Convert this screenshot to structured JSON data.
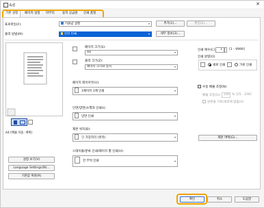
{
  "window": {
    "title": "속성",
    "close_glyph": "✕"
  },
  "tabs": [
    "기본 설정",
    "페이지 설정",
    "마무리",
    "용지 공급원",
    "인쇄 품질"
  ],
  "profile": {
    "label": "프로파일(F):",
    "value": "기본값 설정",
    "add_button": "추가(1)...",
    "edit_button": "편집(2)..."
  },
  "output_method": {
    "label": "출력 방법(M):",
    "value": "보안 인쇄",
    "details_button": "세부 정보(3)..."
  },
  "preview": {
    "caption": "A4 [배율 자동: 계획]"
  },
  "left_buttons": [
    "설정 보기(V)",
    "Language Settings(N)...",
    "기본값 복원(R)"
  ],
  "page_size": {
    "label": "페이지 크기(S):",
    "value": "A4"
  },
  "output_size": {
    "label": "출력 크기(Z):",
    "value": "페이지 크기와 일치"
  },
  "copies": {
    "label": "인쇄 매수(C):",
    "value": "1",
    "range": "[1 - 9999]"
  },
  "orientation": {
    "label": "인쇄 방향(O)",
    "portrait": "세로 인쇄",
    "landscape": "가로 인쇄"
  },
  "page_layout": {
    "label": "페이지 레이아웃(U):",
    "value": "1페이지 1매 인쇄"
  },
  "manual_scaling": {
    "checkbox": "수동 배율 조정(N)",
    "scale_label": "배율 조정(G):",
    "scale_value": "100",
    "scale_range": "% [25 - 200]",
    "fit_label": "원본을 가로/세로에 맞춤(X)"
  },
  "duplex": {
    "label": "단면/양면/소책자 인쇄(I):",
    "value": "양면 인쇄"
  },
  "binding": {
    "label": "제본 위치(B):",
    "value": "긴 가장자리 (왼쪽)",
    "margin_button": "제본 여백(G)..."
  },
  "staple": {
    "label": "스태이플/분류 인쇄/페이지 별 인쇄(H):",
    "value": "한 부씩 인쇄"
  },
  "footer": {
    "ok": "확인",
    "cancel": "취소",
    "help": "도움말"
  }
}
